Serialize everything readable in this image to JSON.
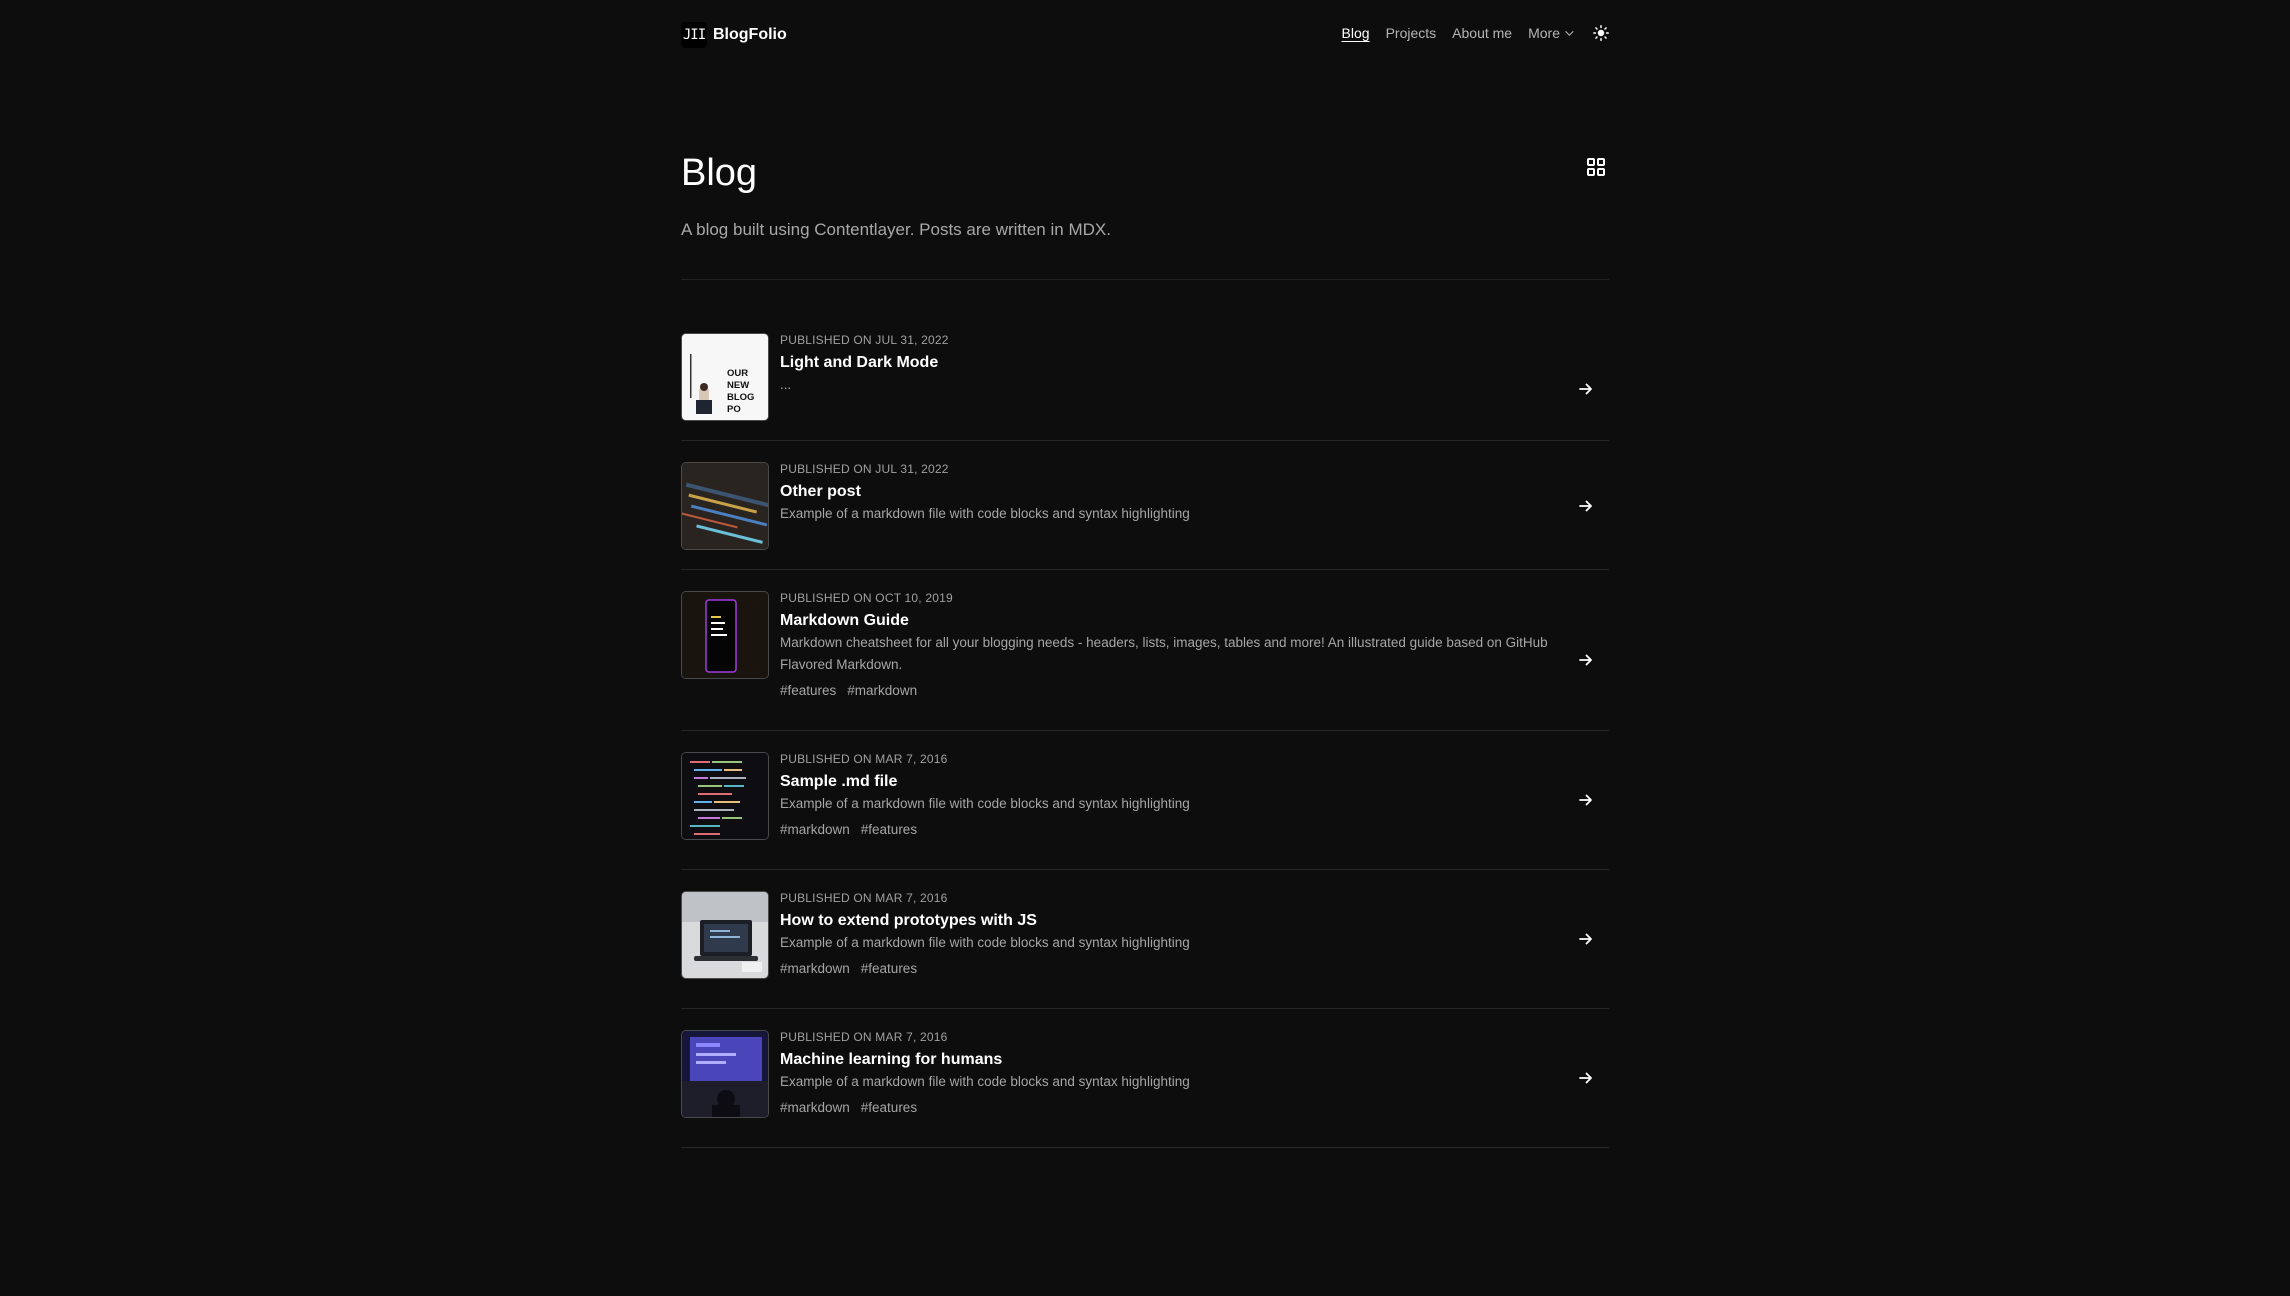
{
  "brand": {
    "mark": "JII",
    "name": "BlogFolio"
  },
  "nav": {
    "blog": "Blog",
    "projects": "Projects",
    "about": "About me",
    "more": "More"
  },
  "page": {
    "title": "Blog",
    "description": "A blog built using Contentlayer. Posts are written in MDX."
  },
  "posts": [
    {
      "date": "PUBLISHED ON JUL 31, 2022",
      "title": "Light and Dark Mode",
      "description": "...",
      "thumb_text": "OUR NEW BLOG PO",
      "tags": []
    },
    {
      "date": "PUBLISHED ON JUL 31, 2022",
      "title": "Other post",
      "description": "Example of a markdown file with code blocks and syntax highlighting",
      "tags": []
    },
    {
      "date": "PUBLISHED ON OCT 10, 2019",
      "title": "Markdown Guide",
      "description": "Markdown cheatsheet for all your blogging needs - headers, lists, images, tables and more! An illustrated guide based on GitHub Flavored Markdown.",
      "tags": [
        "#features",
        "#markdown"
      ]
    },
    {
      "date": "PUBLISHED ON MAR 7, 2016",
      "title": "Sample .md file",
      "description": "Example of a markdown file with code blocks and syntax highlighting",
      "tags": [
        "#markdown",
        "#features"
      ]
    },
    {
      "date": "PUBLISHED ON MAR 7, 2016",
      "title": "How to extend prototypes with JS",
      "description": "Example of a markdown file with code blocks and syntax highlighting",
      "tags": [
        "#markdown",
        "#features"
      ]
    },
    {
      "date": "PUBLISHED ON MAR 7, 2016",
      "title": "Machine learning for humans",
      "description": "Example of a markdown file with code blocks and syntax highlighting",
      "tags": [
        "#markdown",
        "#features"
      ]
    }
  ],
  "colors": {
    "background": "#0d0d0d",
    "text": "#ffffff",
    "muted": "#a6a6a6",
    "divider": "#262626"
  }
}
